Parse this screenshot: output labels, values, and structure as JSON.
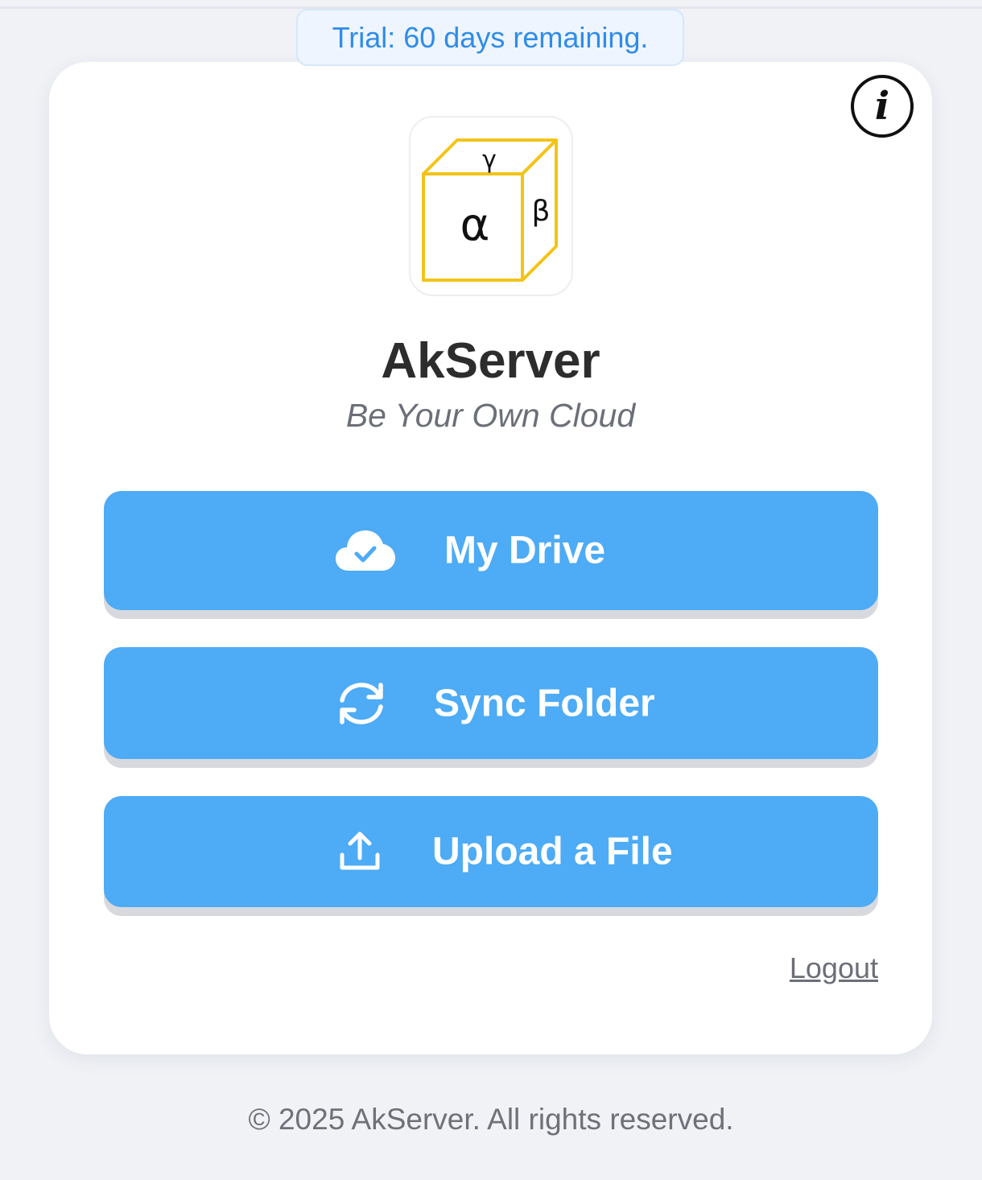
{
  "trial_banner": {
    "text": "Trial: 60 days remaining."
  },
  "card": {
    "info_icon": "info-icon",
    "logo": {
      "icon": "cube-logo",
      "front_symbol": "α",
      "side_symbol": "β",
      "top_symbol": "γ",
      "stroke_color": "#f2c418"
    },
    "title": "AkServer",
    "tagline": "Be Your Own Cloud",
    "actions": [
      {
        "label": "My Drive",
        "icon": "cloud-check-icon"
      },
      {
        "label": "Sync Folder",
        "icon": "sync-icon"
      },
      {
        "label": "Upload a File",
        "icon": "upload-icon"
      }
    ],
    "logout_label": "Logout"
  },
  "footer": {
    "text": "© 2025 AkServer. All rights reserved."
  },
  "colors": {
    "page_background": "#f0f2f6",
    "card_background": "#ffffff",
    "button_primary": "#4eabf5",
    "trial_text": "#2f8ce8",
    "title_text": "#2d2d2d",
    "muted_text": "#6b6f78"
  }
}
